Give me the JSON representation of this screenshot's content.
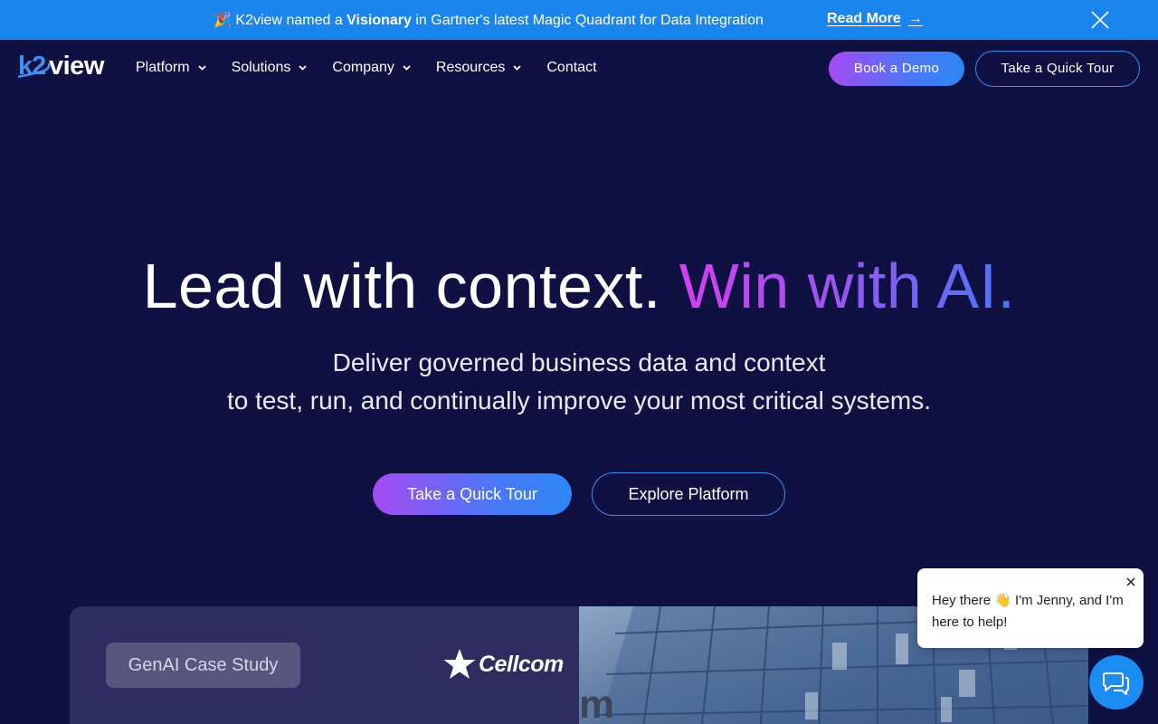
{
  "announcement": {
    "emoji": "🎉",
    "text_before": "K2view named a",
    "highlight": "Visionary",
    "text_after": "in Gartner's latest Magic Quadrant for Data Integration",
    "link_label": "Read More",
    "link_arrow": "→"
  },
  "nav": {
    "brand": "k2view",
    "items": [
      {
        "label": "Platform",
        "has_dropdown": true
      },
      {
        "label": "Solutions",
        "has_dropdown": true
      },
      {
        "label": "Company",
        "has_dropdown": true
      },
      {
        "label": "Resources",
        "has_dropdown": true
      },
      {
        "label": "Contact",
        "has_dropdown": false
      }
    ],
    "cta_primary": "Book a Demo",
    "cta_secondary": "Take a Quick Tour"
  },
  "hero": {
    "title_plain": "Lead with context.",
    "title_gradient": "Win with AI.",
    "subtitle_line1": "Deliver governed business data and context",
    "subtitle_line2": "to test, run, and continually improve your most critical systems.",
    "button_primary": "Take a Quick Tour",
    "button_secondary": "Explore Platform"
  },
  "case_study": {
    "badge": "GenAI Case Study",
    "company_logo": "Cellcom",
    "image_fragment": "m"
  },
  "chat": {
    "message": "Hey there 👋 I'm Jenny, and I'm here to help!"
  },
  "colors": {
    "background": "#0f1142",
    "announcement_bg": "#1a85ec",
    "gradient_start": "#d43ef1",
    "gradient_end": "#4a76f7",
    "accent_border": "#3a8ef0",
    "chat_launcher": "#1a8cf2"
  },
  "icons": {
    "announcement_close": "close-icon",
    "dropdown": "chevron-down-icon",
    "chat_close": "close-icon",
    "chat_launcher": "chat-bubbles-icon"
  }
}
